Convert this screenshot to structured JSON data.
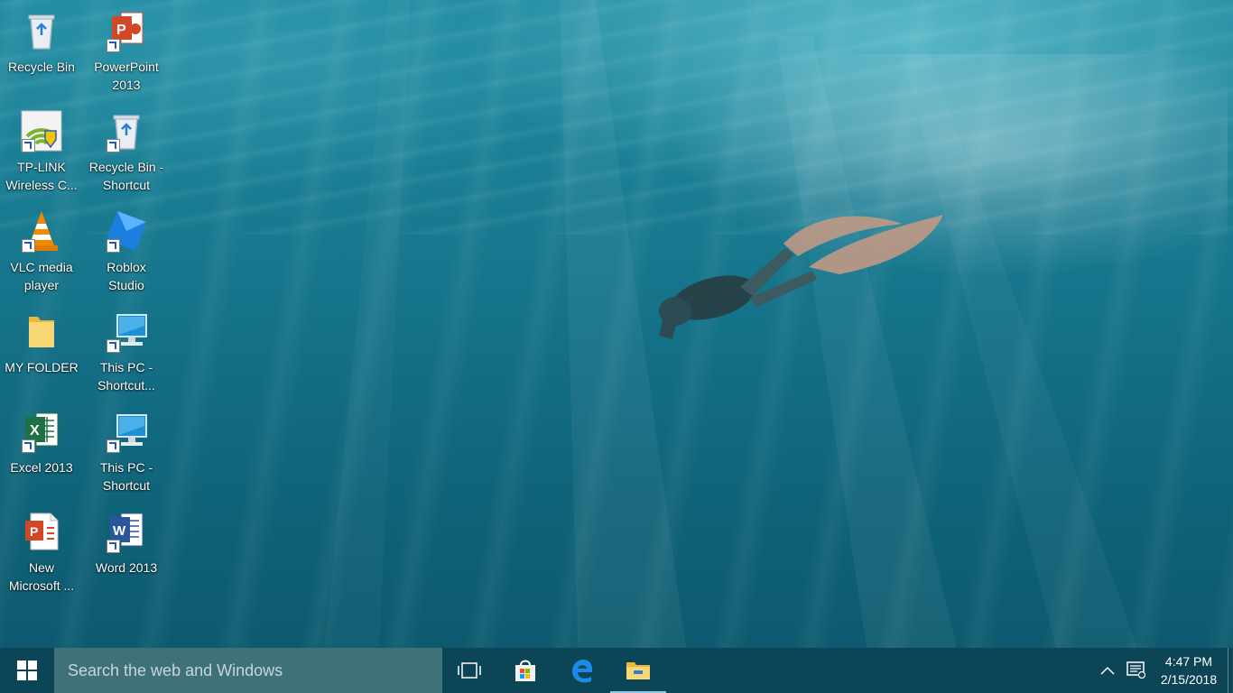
{
  "desktop": {
    "icons": [
      {
        "label": "Recycle Bin",
        "icon": "recycle-bin-icon",
        "shortcut": false
      },
      {
        "label": "PowerPoint\n2013",
        "icon": "powerpoint-icon",
        "shortcut": true
      },
      {
        "label": "TP-LINK\nWireless C...",
        "icon": "wifi-utility-icon",
        "shortcut": true
      },
      {
        "label": "Recycle Bin -\nShortcut",
        "icon": "recycle-bin-icon",
        "shortcut": true
      },
      {
        "label": "VLC media\nplayer",
        "icon": "vlc-cone-icon",
        "shortcut": true
      },
      {
        "label": "Roblox\nStudio",
        "icon": "roblox-studio-icon",
        "shortcut": true
      },
      {
        "label": "MY FOLDER",
        "icon": "folder-icon",
        "shortcut": false
      },
      {
        "label": "This PC -\nShortcut...",
        "icon": "computer-icon",
        "shortcut": true
      },
      {
        "label": "Excel 2013",
        "icon": "excel-icon",
        "shortcut": true
      },
      {
        "label": "This PC -\nShortcut",
        "icon": "computer-icon",
        "shortcut": true
      },
      {
        "label": "New\nMicrosoft ...",
        "icon": "powerpoint-document-icon",
        "shortcut": false
      },
      {
        "label": "Word 2013",
        "icon": "word-icon",
        "shortcut": true
      }
    ]
  },
  "taskbar": {
    "search_placeholder": "Search the web and Windows",
    "pinned": [
      {
        "name": "task-view",
        "icon": "task-view-icon"
      },
      {
        "name": "store",
        "icon": "store-bag-icon"
      },
      {
        "name": "edge",
        "icon": "edge-browser-icon"
      },
      {
        "name": "file-explorer",
        "icon": "folder-icon"
      }
    ],
    "tray": {
      "time": "4:47 PM",
      "date": "2/15/2018"
    }
  },
  "colors": {
    "taskbar": "#0c4656",
    "search_box": "#3f7179",
    "water_light": "#1f8aa0",
    "water_deep": "#0d5a6f"
  }
}
